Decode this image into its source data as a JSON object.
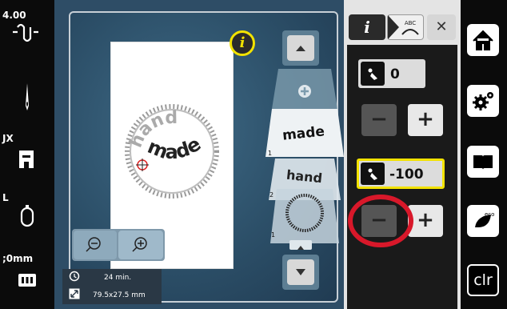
{
  "left": {
    "tension": "4.00",
    "presser_foot": "JX",
    "hoop_size": "L",
    "thread_length": ";0mm"
  },
  "main": {
    "info_label": "i",
    "design_text": {
      "line1": "hand",
      "line2": "made"
    },
    "layers": [
      {
        "text": "made",
        "number": "1"
      },
      {
        "text": "hand",
        "number": "2"
      },
      {
        "number": "1"
      }
    ],
    "stitch_time": "24 min.",
    "design_size": "79.5x27.5 mm"
  },
  "panel": {
    "info_label": "i",
    "abc_label": "ABC",
    "close_label": "✕",
    "value1": "0",
    "value2": "-100",
    "minus": "−",
    "plus": "+"
  },
  "right": {
    "eco_label": "eco",
    "clr_label": "clr"
  },
  "colors": {
    "highlight_yellow": "#f2e200",
    "annotation_red": "#d8182a",
    "canvas_blue": "#2e4d66"
  }
}
